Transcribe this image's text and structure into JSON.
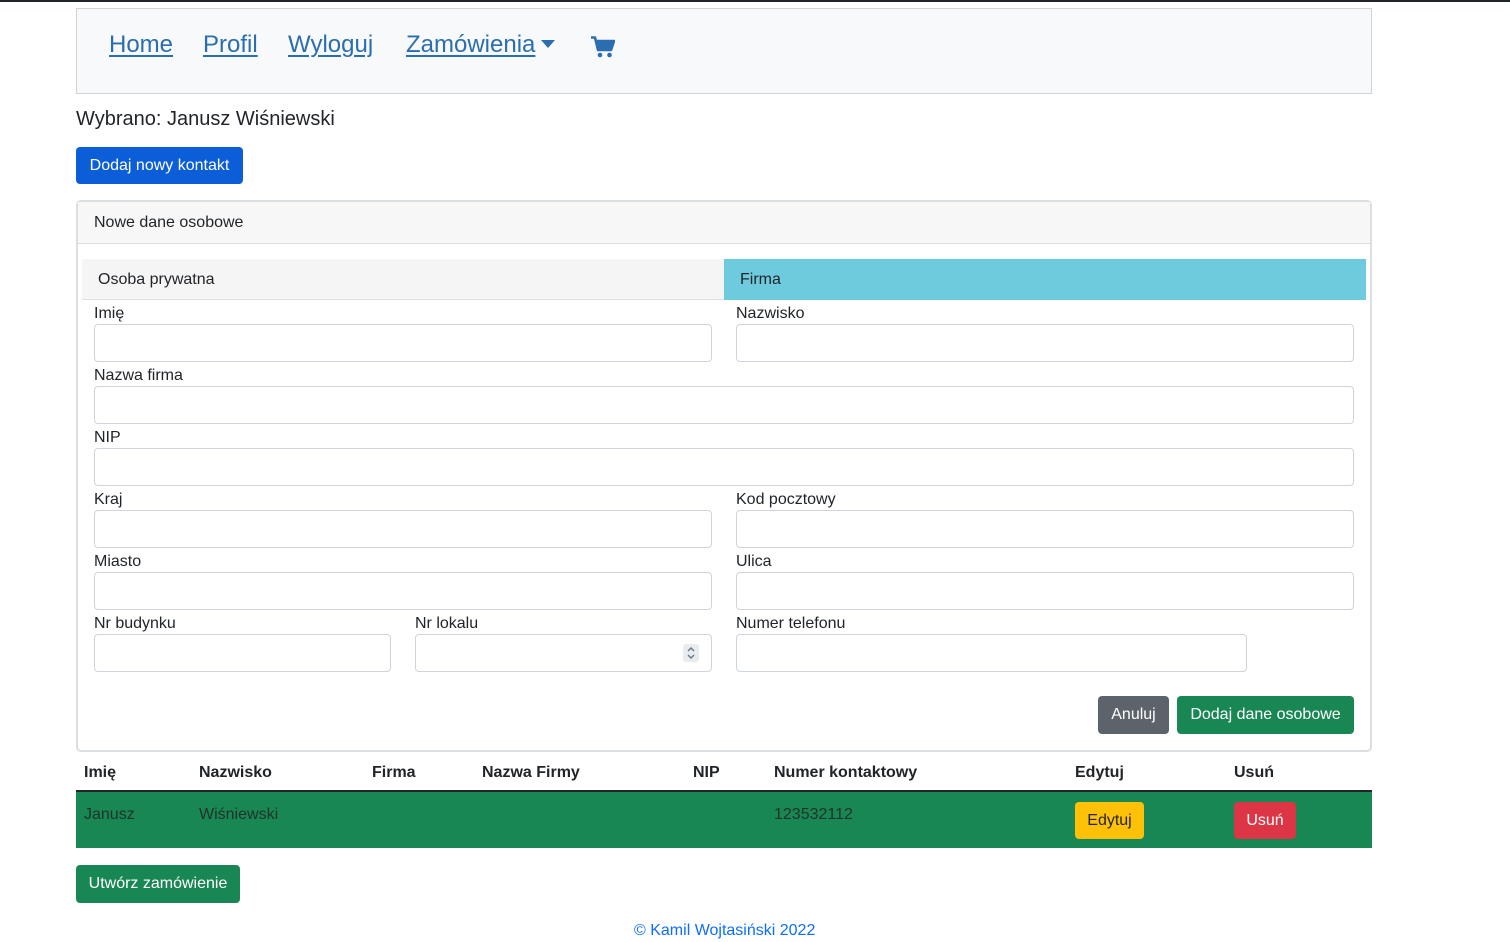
{
  "nav": {
    "home": "Home",
    "profile": "Profil",
    "logout": "Wyloguj",
    "orders": "Zamówienia",
    "cart_icon": "shopping-cart-icon"
  },
  "selected_text": "Wybrano: Janusz Wiśniewski",
  "add_contact_button": "Dodaj nowy kontakt",
  "form": {
    "title": "Nowe dane osobowe",
    "tabs": {
      "private": "Osoba prywatna",
      "company": "Firma"
    },
    "labels": {
      "first_name": "Imię",
      "last_name": "Nazwisko",
      "company_name": "Nazwa firma",
      "nip": "NIP",
      "country": "Kraj",
      "postal_code": "Kod pocztowy",
      "city": "Miasto",
      "street": "Ulica",
      "building_no": "Nr budynku",
      "apartment_no": "Nr lokalu",
      "phone": "Numer telefonu"
    },
    "values": {
      "first_name": "",
      "last_name": "",
      "company_name": "",
      "nip": "",
      "country": "",
      "postal_code": "",
      "city": "",
      "street": "",
      "building_no": "",
      "apartment_no": "",
      "phone": ""
    },
    "cancel_button": "Anuluj",
    "submit_button": "Dodaj dane osobowe"
  },
  "table": {
    "headers": [
      "Imię",
      "Nazwisko",
      "Firma",
      "Nazwa Firmy",
      "NIP",
      "Numer kontaktowy",
      "Edytuj",
      "Usuń"
    ],
    "rows": [
      {
        "first_name": "Janusz",
        "last_name": "Wiśniewski",
        "company": "",
        "company_name": "",
        "nip": "",
        "phone": "123532112",
        "edit_button": "Edytuj",
        "delete_button": "Usuń"
      }
    ]
  },
  "create_order_button": "Utwórz zamówienie",
  "footer": "© Kamil Wojtasiński 2022",
  "colors": {
    "primary": "#0b5ed7",
    "success": "#198754",
    "secondary": "#5c636a",
    "warning": "#ffc107",
    "danger": "#dc3545",
    "tab_active": "#6ecbdd",
    "link": "#2a6db0"
  }
}
